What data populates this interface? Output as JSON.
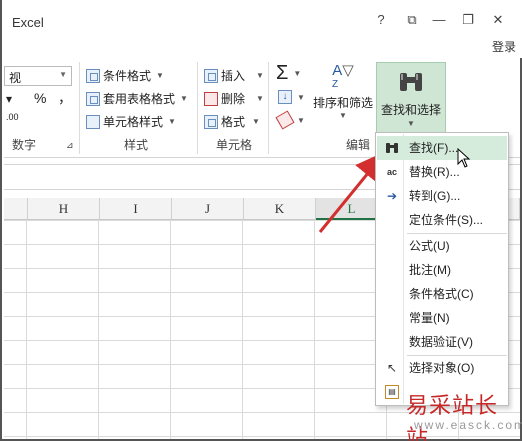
{
  "window": {
    "app_title": "Excel",
    "help": "?",
    "ribbon_display": "⧉",
    "minimize": "—",
    "restore": "❐",
    "close": "✕",
    "login": "登录"
  },
  "ribbon": {
    "number": {
      "format_value": "视",
      "percent": "%",
      "comma": "，",
      "decimals": ".00",
      "label": "数字"
    },
    "styles": {
      "conditional_format": "条件格式",
      "format_as_table": "套用表格格式",
      "cell_styles": "单元格样式",
      "label": "样式"
    },
    "cells": {
      "insert": "插入",
      "delete": "删除",
      "format": "格式",
      "label": "单元格"
    },
    "editing": {
      "sum_icon": "Σ",
      "sort_filter": "排序和筛选",
      "find_select": "查找和选择",
      "label": "编辑"
    }
  },
  "sheet": {
    "columns": [
      "H",
      "I",
      "J",
      "K",
      "L"
    ],
    "active_column": "L"
  },
  "menu": {
    "items": [
      {
        "label": "查找(F)...",
        "icon": "binoculars-icon"
      },
      {
        "label": "替换(R)...",
        "icon": "replace-icon"
      },
      {
        "label": "转到(G)...",
        "icon": "arrow-right-icon"
      },
      {
        "label": "定位条件(S)...",
        "icon": ""
      },
      {
        "label": "公式(U)",
        "icon": ""
      },
      {
        "label": "批注(M)",
        "icon": ""
      },
      {
        "label": "条件格式(C)",
        "icon": ""
      },
      {
        "label": "常量(N)",
        "icon": ""
      },
      {
        "label": "数据验证(V)",
        "icon": ""
      },
      {
        "label": "选择对象(O)",
        "icon": "cursor-icon"
      },
      {
        "label": "",
        "icon": "selection-pane-icon"
      }
    ],
    "highlighted_index": 0
  },
  "watermark": {
    "text": "易采站长站",
    "url": "www.easck.com"
  },
  "colors": {
    "accent": "#217346",
    "highlight": "#d5ecdc",
    "arrow": "#d32f2f"
  }
}
